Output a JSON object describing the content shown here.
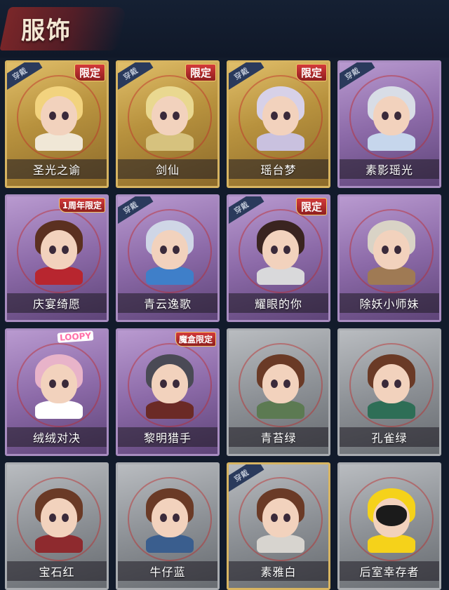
{
  "header": {
    "title": "服饰"
  },
  "tags": {
    "equipped": "穿戴"
  },
  "cards": [
    {
      "name": "圣光之谕",
      "frame": "gold",
      "equipped": true,
      "badge": "限定",
      "hair": "#f2d37e",
      "outfit": "#f0e7d6"
    },
    {
      "name": "剑仙",
      "frame": "gold",
      "equipped": true,
      "badge": "限定",
      "hair": "#e9d890",
      "outfit": "#d6c27e"
    },
    {
      "name": "瑶台梦",
      "frame": "gold",
      "equipped": true,
      "badge": "限定",
      "hair": "#d7d1e8",
      "outfit": "#c9c1df"
    },
    {
      "name": "素影瑶光",
      "frame": "purple",
      "equipped": true,
      "badge": "",
      "hair": "#d8dde6",
      "outfit": "#c6d6ec"
    },
    {
      "name": "庆宴绮愿",
      "frame": "purple",
      "equipped": false,
      "badge": "1周年限定",
      "hair": "#5b3020",
      "outfit": "#b8262f"
    },
    {
      "name": "青云逸歌",
      "frame": "purple",
      "equipped": true,
      "badge": "",
      "hair": "#cfd6e6",
      "outfit": "#3f7fc9"
    },
    {
      "name": "耀眼的你",
      "frame": "purple",
      "equipped": true,
      "badge": "限定",
      "hair": "#3a2420",
      "outfit": "#d9d9db"
    },
    {
      "name": "除妖小师妹",
      "frame": "purple",
      "equipped": false,
      "badge": "",
      "hair": "#d9d3c6",
      "outfit": "#9f7a54"
    },
    {
      "name": "绒绒对决",
      "frame": "purple",
      "equipped": false,
      "badge": "",
      "logo": "LOOPY",
      "hair": "#e8b3c9",
      "outfit": "#ffffff"
    },
    {
      "name": "黎明猎手",
      "frame": "purple",
      "equipped": false,
      "badge": "魔盒限定",
      "hair": "#4a4a55",
      "outfit": "#6b2a26"
    },
    {
      "name": "青苔绿",
      "frame": "silver",
      "equipped": false,
      "badge": "",
      "hair": "#6a3a26",
      "outfit": "#5c7a52"
    },
    {
      "name": "孔雀绿",
      "frame": "silver",
      "equipped": false,
      "badge": "",
      "hair": "#6a3a26",
      "outfit": "#2e6e56"
    },
    {
      "name": "宝石红",
      "frame": "silver",
      "equipped": false,
      "badge": "",
      "hair": "#6a3a26",
      "outfit": "#8e2a2e"
    },
    {
      "name": "牛仔蓝",
      "frame": "silver",
      "equipped": false,
      "badge": "",
      "hair": "#6a3a26",
      "outfit": "#3a5e8e"
    },
    {
      "name": "素雅白",
      "frame": "silver-equipped",
      "equipped": true,
      "badge": "",
      "hair": "#6a3a26",
      "outfit": "#d7d4cf"
    },
    {
      "name": "后室幸存者",
      "frame": "silver",
      "equipped": false,
      "badge": "",
      "hazmat": true,
      "hair": "#f5d21a",
      "outfit": "#f5d21a"
    }
  ]
}
